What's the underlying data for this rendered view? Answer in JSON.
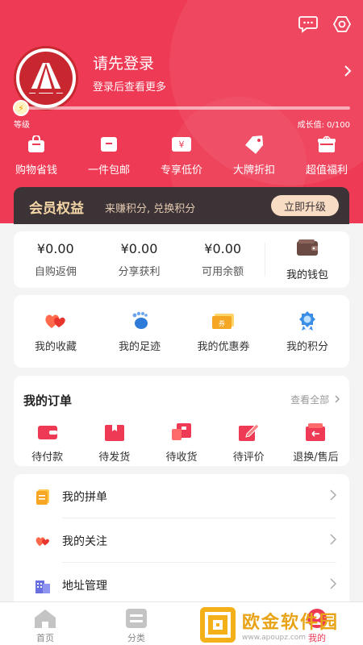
{
  "header": {
    "login_title": "请先登录",
    "login_subtitle": "登录后查看更多",
    "level_label": "等级",
    "growth_text": "成长值: 0/100",
    "perks": [
      {
        "label": "购物省钱",
        "icon": "bag-icon"
      },
      {
        "label": "一件包邮",
        "icon": "box-icon"
      },
      {
        "label": "专享低价",
        "icon": "yen-tag-icon"
      },
      {
        "label": "大牌折扣",
        "icon": "price-tag-icon"
      },
      {
        "label": "超值福利",
        "icon": "gift-icon"
      }
    ]
  },
  "member": {
    "title": "会员权益",
    "subtitle": "来赚积分, 兑换积分",
    "button": "立即升级"
  },
  "wallet": {
    "items": [
      {
        "value": "¥0.00",
        "label": "自购返佣"
      },
      {
        "value": "¥0.00",
        "label": "分享获利"
      },
      {
        "value": "¥0.00",
        "label": "可用余额"
      }
    ],
    "my_wallet": "我的钱包"
  },
  "quick": [
    {
      "label": "我的收藏",
      "icon": "hearts-icon"
    },
    {
      "label": "我的足迹",
      "icon": "footprint-icon"
    },
    {
      "label": "我的优惠券",
      "icon": "coupon-icon"
    },
    {
      "label": "我的积分",
      "icon": "medal-icon"
    }
  ],
  "orders": {
    "title": "我的订单",
    "view_all": "查看全部",
    "items": [
      {
        "label": "待付款",
        "icon": "wallet-icon"
      },
      {
        "label": "待发货",
        "icon": "package-icon"
      },
      {
        "label": "待收货",
        "icon": "truck-icon"
      },
      {
        "label": "待评价",
        "icon": "edit-icon"
      },
      {
        "label": "退换/售后",
        "icon": "return-icon"
      }
    ]
  },
  "menu": [
    {
      "label": "我的拼单",
      "icon": "group-order-icon"
    },
    {
      "label": "我的关注",
      "icon": "follow-hearts-icon"
    },
    {
      "label": "地址管理",
      "icon": "building-icon"
    }
  ],
  "tabbar": [
    {
      "label": "首页",
      "icon": "home-icon"
    },
    {
      "label": "分类",
      "icon": "category-icon"
    },
    {
      "label": "我的",
      "icon": "user-icon"
    }
  ],
  "watermark": {
    "name": "欧金软件园",
    "url": "www.apoupz.com"
  },
  "colors": {
    "brand_red": "#ee3a54",
    "member_dark": "#3c3336",
    "member_gold": "#f4d6a6"
  }
}
